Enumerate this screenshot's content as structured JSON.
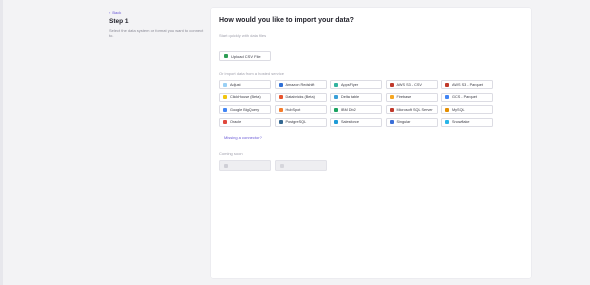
{
  "nav": {
    "back_label": "Back"
  },
  "step": {
    "title": "Step 1",
    "description": "Select the data system or format you want to connect to."
  },
  "main": {
    "title": "How would you like to import your data?",
    "quick_label": "Start quickly with data files",
    "upload_label": "Upload CSV File",
    "import_label": "Or import data from a hosted service",
    "missing_link": "Missing a connector?",
    "coming_label": "Coming soon",
    "coming_items": [
      "",
      ""
    ]
  },
  "sources": [
    {
      "label": "Adjust",
      "color": "#9ad0f5"
    },
    {
      "label": "Amazon Redshift",
      "color": "#2f6fd6"
    },
    {
      "label": "AppsFlyer",
      "color": "#34b3a0"
    },
    {
      "label": "AWS S3 - CSV",
      "color": "#c0392b"
    },
    {
      "label": "AWS S3 - Parquet",
      "color": "#c0392b"
    },
    {
      "label": "ClickHouse (Beta)",
      "color": "#f1c40f"
    },
    {
      "label": "Databricks (Beta)",
      "color": "#e8552f"
    },
    {
      "label": "Delta table",
      "color": "#3aa0d8"
    },
    {
      "label": "Firebase",
      "color": "#f5a623"
    },
    {
      "label": "GCS - Parquet",
      "color": "#4285f4"
    },
    {
      "label": "Google BigQuery",
      "color": "#4285f4"
    },
    {
      "label": "HubSpot",
      "color": "#f57c2b"
    },
    {
      "label": "IBM Db2",
      "color": "#1aa260"
    },
    {
      "label": "Microsoft SQL Server",
      "color": "#c0392b"
    },
    {
      "label": "MySQL",
      "color": "#e48e00"
    },
    {
      "label": "Oracle",
      "color": "#e0483d"
    },
    {
      "label": "PostgreSQL",
      "color": "#336791"
    },
    {
      "label": "Salesforce",
      "color": "#1e9bd7"
    },
    {
      "label": "Singular",
      "color": "#3b6fd8"
    },
    {
      "label": "Snowflake",
      "color": "#29b5e8"
    }
  ]
}
